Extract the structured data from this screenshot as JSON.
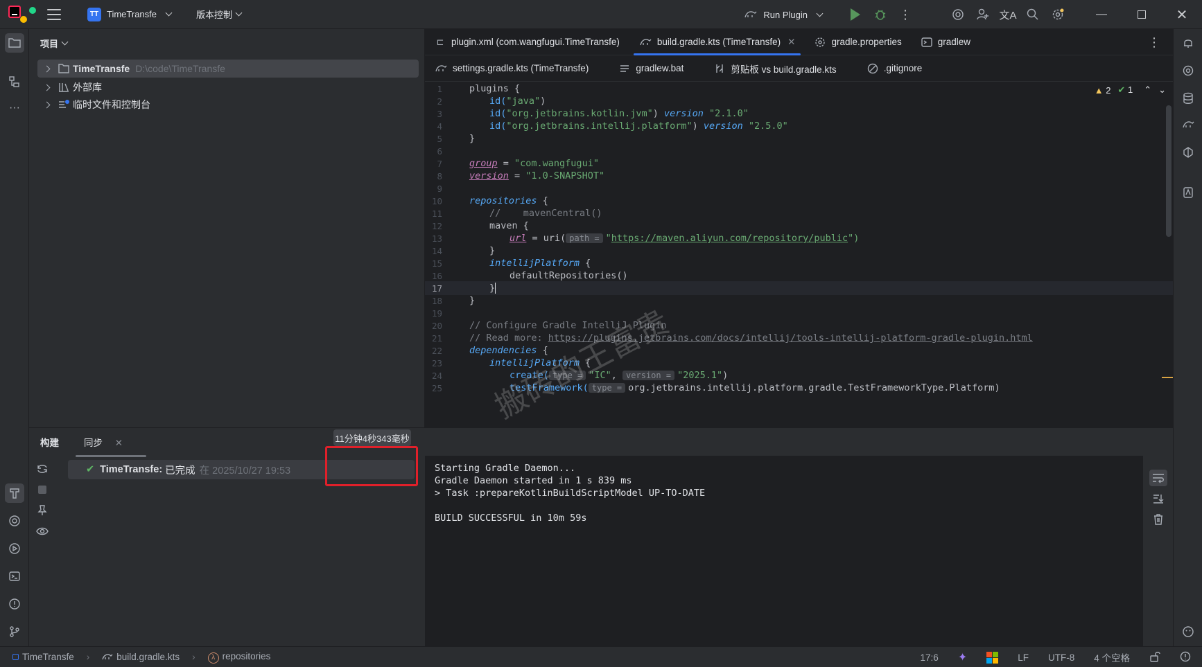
{
  "titlebar": {
    "project_badge": "TT",
    "project_name": "TimeTransfe",
    "vcs_label": "版本控制",
    "run_config": "Run Plugin",
    "icons": [
      "ide-logo-icon",
      "main-menu-icon",
      "run-icon",
      "debug-icon",
      "more-icon",
      "ai-assistant-icon",
      "add-user-icon",
      "translate-icon",
      "search-icon",
      "settings-icon",
      "minimize-icon",
      "maximize-icon",
      "close-icon"
    ]
  },
  "project_panel": {
    "title": "项目",
    "tree": [
      {
        "label": "TimeTransfe",
        "path": "D:\\code\\TimeTransfe"
      },
      {
        "label": "外部库"
      },
      {
        "label": "临时文件和控制台"
      }
    ]
  },
  "editor": {
    "tabs_row1": [
      {
        "label": "plugin.xml (com.wangfugui.TimeTransfe)",
        "icon": "plugin-icon"
      },
      {
        "label": "build.gradle.kts (TimeTransfe)",
        "icon": "gradle-icon",
        "active": true
      },
      {
        "label": "gradle.properties",
        "icon": "gear-icon"
      },
      {
        "label": "gradlew",
        "icon": "terminal-icon"
      }
    ],
    "tabs_row2": [
      {
        "label": "settings.gradle.kts (TimeTransfe)",
        "icon": "gradle-icon"
      },
      {
        "label": "gradlew.bat",
        "icon": "text-file-icon"
      },
      {
        "label": "剪贴板 vs build.gradle.kts",
        "icon": "diff-icon"
      },
      {
        "label": ".gitignore",
        "icon": "ignore-icon"
      }
    ],
    "inspections": {
      "warnings": "2",
      "ok": "1"
    },
    "line_numbers": [
      "1",
      "2",
      "3",
      "4",
      "5",
      "6",
      "7",
      "8",
      "9",
      "10",
      "11",
      "12",
      "13",
      "14",
      "15",
      "16",
      "17",
      "18",
      "19",
      "20",
      "21",
      "22",
      "23",
      "24",
      "25"
    ],
    "current_line": 17,
    "code": {
      "l1": "plugins {",
      "l2_fn": "id(",
      "l2_str": "\"java\"",
      "l2_end": ")",
      "l3_fn": "id(",
      "l3_str": "\"org.jetbrains.kotlin.jvm\"",
      "l3_mid": ") ",
      "l3_kw": "version",
      "l3_ver": " \"2.1.0\"",
      "l4_fn": "id(",
      "l4_str": "\"org.jetbrains.intellij.platform\"",
      "l4_mid": ") ",
      "l4_kw": "version",
      "l4_ver": " \"2.5.0\"",
      "l5": "}",
      "l7_prop": "group",
      "l7_eq": " = ",
      "l7_str": "\"com.wangfugui\"",
      "l8_prop": "version",
      "l8_eq": " = ",
      "l8_str": "\"1.0-SNAPSHOT\"",
      "l10_fn": "repositories",
      "l10_end": " {",
      "l11": "//    mavenCentral()",
      "l12": "maven {",
      "l13_prop": "url",
      "l13_eq": " = uri(",
      "l13_hint": "path =",
      "l13_q1": "\"",
      "l13_link": "https://maven.aliyun.com/repository/public",
      "l13_end": "\")",
      "l14": "}",
      "l15_fn": "intellijPlatform",
      "l15_end": " {",
      "l16": "defaultRepositories()",
      "l17": "}",
      "l18": "}",
      "l20": "// Configure Gradle IntelliJ Plugin",
      "l21_pre": "// Read more: ",
      "l21_link": "https://plugins.jetbrains.com/docs/intellij/tools-intellij-platform-gradle-plugin.html",
      "l22_fn": "dependencies",
      "l22_end": " {",
      "l23_fn": "intellijPlatform",
      "l23_end": " {",
      "l24_pre": "create(",
      "l24_hint1": "type =",
      "l24_str1": "\"IC\"",
      "l24_sep": ", ",
      "l24_hint2": "version =",
      "l24_str2": "\"2025.1\"",
      "l24_end": ")",
      "l25_pre": "testFramework(",
      "l25_hint": "type =",
      "l25_rest": "org.jetbrains.intellij.platform.gradle.TestFrameworkType.Platform)"
    },
    "watermark": "搬砖的王富贵"
  },
  "build_panel": {
    "tab_build": "构建",
    "tab_sync": "同步",
    "task_name": "TimeTransfe:",
    "task_status": "已完成",
    "task_time": "在 2025/10/27 19:53",
    "duration": "11分钟4秒343毫秒",
    "console_lines": [
      "Starting Gradle Daemon...",
      "Gradle Daemon started in 1 s 839 ms",
      "> Task :prepareKotlinBuildScriptModel UP-TO-DATE",
      "",
      "BUILD SUCCESSFUL in 10m 59s"
    ]
  },
  "statusbar": {
    "breadcrumb": [
      "TimeTransfe",
      "build.gradle.kts",
      "repositories"
    ],
    "position": "17:6",
    "line_sep": "LF",
    "encoding": "UTF-8",
    "indent": "4 个空格"
  },
  "colors": {
    "accent": "#3574f0",
    "success": "#5fb865",
    "warning": "#f2c55c",
    "highlight_box": "#e0202a"
  }
}
